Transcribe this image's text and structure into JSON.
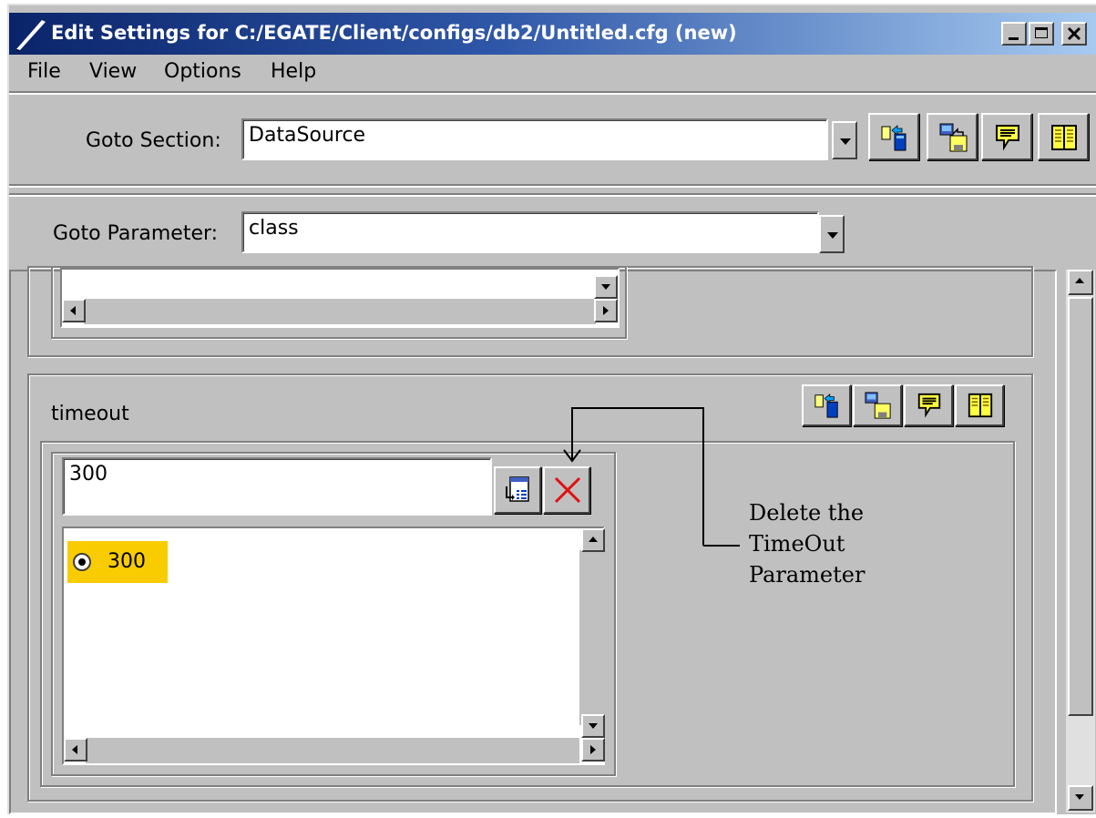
{
  "window": {
    "title": "Edit Settings for C:/EGATE/Client/configs/db2/Untitled.cfg (new)",
    "minimize_label": "_",
    "maximize_label": "□",
    "close_label": "✕"
  },
  "menu": {
    "items": [
      {
        "label": "File"
      },
      {
        "label": "View"
      },
      {
        "label": "Options"
      },
      {
        "label": "Help"
      }
    ]
  },
  "goto_section": {
    "label": "Goto Section:",
    "value": "DataSource"
  },
  "goto_parameter": {
    "label": "Goto Parameter:",
    "value": "class"
  },
  "parameter": {
    "name": "timeout",
    "input_value": "300",
    "options": [
      {
        "label": "300",
        "selected": true
      }
    ],
    "highlight_color": "#f8cc00"
  },
  "annotation": {
    "lines": [
      "Delete the",
      "TimeOut",
      "Parameter"
    ]
  },
  "icons": {
    "toolbar": [
      "copy-to-device-icon",
      "save-disk-icon",
      "comment-bubble-icon",
      "book-help-icon"
    ],
    "value_tools": [
      "list-insert-icon",
      "delete-x-icon"
    ]
  },
  "colors": {
    "window_bg": "#c0c0c0",
    "titlebar_start": "#0a246a",
    "titlebar_end": "#a6caf0",
    "delete_red": "#e01010"
  }
}
